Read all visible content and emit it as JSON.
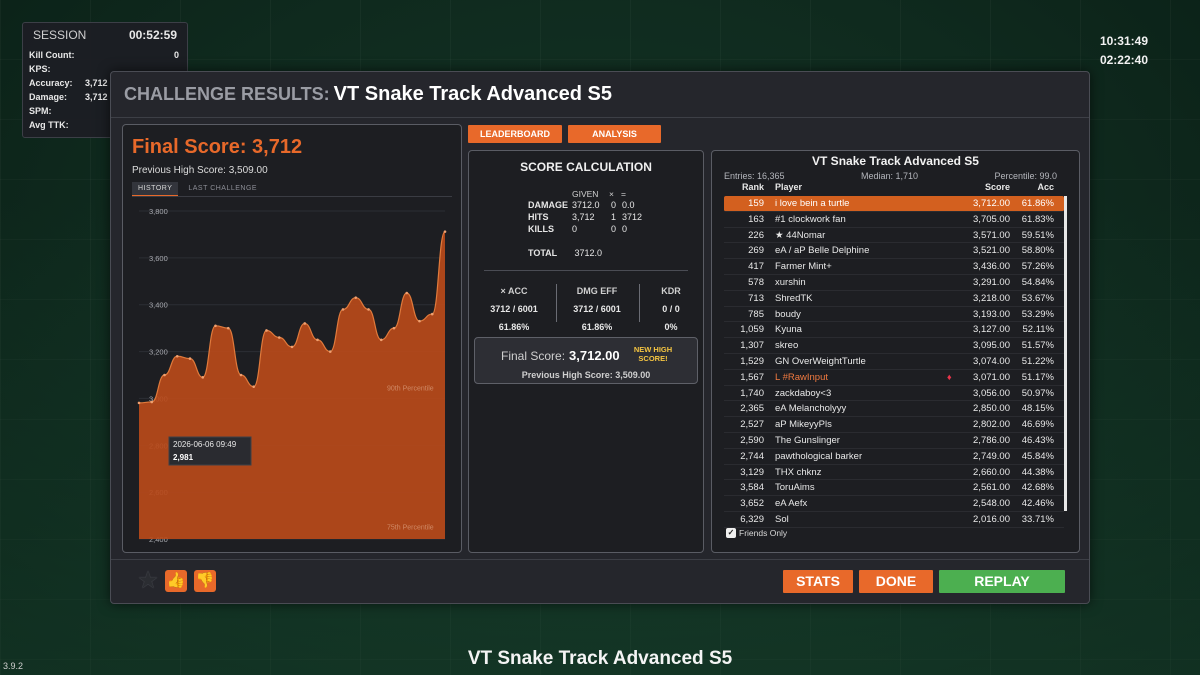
{
  "session": {
    "label": "SESSION",
    "time": "00:52:59",
    "rows": [
      {
        "key": "Kill Count:",
        "value": "0",
        "right": true
      },
      {
        "key": "KPS:",
        "value": "",
        "right": false
      },
      {
        "key": "Accuracy:",
        "value": "3,712",
        "right": false
      },
      {
        "key": "Damage:",
        "value": "3,712",
        "right": false
      },
      {
        "key": "SPM:",
        "value": "",
        "right": false
      },
      {
        "key": "Avg TTK:",
        "value": "",
        "right": false
      }
    ]
  },
  "clock": {
    "time": "10:31:49",
    "elapsed": "02:22:40"
  },
  "version": "3.9.2",
  "bottom_title": "VT Snake Track Advanced S5",
  "panel": {
    "prefix": "CHALLENGE RESULTS:",
    "name": "VT Snake Track Advanced S5"
  },
  "history": {
    "final_label": "Final Score: 3,712",
    "prev_high": "Previous High Score: 3,509.00",
    "tabs": [
      "HISTORY",
      "LAST CHALLENGE"
    ],
    "tooltip_date": "2026-06-06 09:49",
    "tooltip_value": "2,981",
    "ref_90": "90th Percentile",
    "ref_75": "75th Percentile"
  },
  "tabs": {
    "leaderboard": "LEADERBOARD",
    "analysis": "ANALYSIS"
  },
  "calc": {
    "title": "SCORE CALCULATION",
    "head_given": "GIVEN",
    "head_x": "×",
    "head_eq": "=",
    "rows": [
      {
        "k": "DAMAGE",
        "a": "3712.0",
        "b": "0",
        "c": "0.0"
      },
      {
        "k": "HITS",
        "a": "3,712",
        "b": "1",
        "c": "3712"
      },
      {
        "k": "KILLS",
        "a": "0",
        "b": "0",
        "c": "0"
      }
    ],
    "total_k": "TOTAL",
    "total_v": "3712.0",
    "acc_h": "× ACC",
    "acc_1": "3712 / 6001",
    "acc_2": "61.86%",
    "dmg_h": "DMG EFF",
    "dmg_1": "3712 / 6001",
    "dmg_2": "61.86%",
    "kdr_h": "KDR",
    "kdr_1": "0 / 0",
    "kdr_2": "0%",
    "final_label": "Final Score:",
    "final_value": "3,712.00",
    "new_high": "NEW HIGH SCORE!",
    "prev_high": "Previous High Score: 3,509.00"
  },
  "leaderboard": {
    "title": "VT Snake Track Advanced S5",
    "entries": "Entries: 16,365",
    "median": "Median: 1,710",
    "percentile": "Percentile: 99.0",
    "head": {
      "rank": "Rank",
      "player": "Player",
      "score": "Score",
      "acc": "Acc"
    },
    "rows": [
      {
        "rank": "159",
        "player": "i love bein a turtle",
        "score": "3,712.00",
        "acc": "61.86%"
      },
      {
        "rank": "163",
        "player": "#1 clockwork fan",
        "score": "3,705.00",
        "acc": "61.83%"
      },
      {
        "rank": "226",
        "player": "★ 44Nomar",
        "score": "3,571.00",
        "acc": "59.51%"
      },
      {
        "rank": "269",
        "player": "eA / aP Belle Delphine",
        "score": "3,521.00",
        "acc": "58.80%"
      },
      {
        "rank": "417",
        "player": "Farmer Mint+",
        "score": "3,436.00",
        "acc": "57.26%"
      },
      {
        "rank": "578",
        "player": "xurshin",
        "score": "3,291.00",
        "acc": "54.84%"
      },
      {
        "rank": "713",
        "player": "ShredTK",
        "score": "3,218.00",
        "acc": "53.67%"
      },
      {
        "rank": "785",
        "player": "boudy",
        "score": "3,193.00",
        "acc": "53.29%"
      },
      {
        "rank": "1,059",
        "player": "Kyuna",
        "score": "3,127.00",
        "acc": "52.11%"
      },
      {
        "rank": "1,307",
        "player": "skreo",
        "score": "3,095.00",
        "acc": "51.57%"
      },
      {
        "rank": "1,529",
        "player": "GN OverWeightTurtle",
        "score": "3,074.00",
        "acc": "51.22%"
      },
      {
        "rank": "1,567",
        "player": "L #RawInput",
        "score": "3,071.00",
        "acc": "51.17%"
      },
      {
        "rank": "1,740",
        "player": "zackdaboy<3",
        "score": "3,056.00",
        "acc": "50.97%"
      },
      {
        "rank": "2,365",
        "player": "eA Melancholyyy",
        "score": "2,850.00",
        "acc": "48.15%"
      },
      {
        "rank": "2,527",
        "player": "aP MikeyyPls",
        "score": "2,802.00",
        "acc": "46.69%"
      },
      {
        "rank": "2,590",
        "player": "The Gunslinger",
        "score": "2,786.00",
        "acc": "46.43%"
      },
      {
        "rank": "2,744",
        "player": "pawthological barker",
        "score": "2,749.00",
        "acc": "45.84%"
      },
      {
        "rank": "3,129",
        "player": "THX chknz",
        "score": "2,660.00",
        "acc": "44.38%"
      },
      {
        "rank": "3,584",
        "player": "ToruAims",
        "score": "2,561.00",
        "acc": "42.68%"
      },
      {
        "rank": "3,652",
        "player": "eA Aefx",
        "score": "2,548.00",
        "acc": "42.46%"
      },
      {
        "rank": "6,329",
        "player": "Sol",
        "score": "2,016.00",
        "acc": "33.71%"
      }
    ],
    "friends_only": "Friends Only"
  },
  "footer": {
    "stats": "STATS",
    "done": "DONE",
    "replay": "REPLAY"
  },
  "colors": {
    "accent": "#e8692a",
    "replay": "#4caf50",
    "area": "#b84a1a"
  },
  "chart_data": {
    "type": "area",
    "title": "",
    "ylim": [
      2400,
      3800
    ],
    "yticks": [
      "3,800",
      "3,600",
      "3,400",
      "3,200",
      "3,000",
      "2,800",
      "2,600",
      "2,400"
    ],
    "values": [
      2981,
      2985,
      3100,
      3180,
      3170,
      3090,
      3310,
      3300,
      3100,
      3050,
      3290,
      3260,
      3220,
      3320,
      3250,
      3200,
      3380,
      3430,
      3380,
      3250,
      3300,
      3450,
      3330,
      3360,
      3712
    ],
    "ref_lines": [
      {
        "label": "90th Percentile",
        "value": 3000
      },
      {
        "label": "75th Percentile",
        "value": 2440
      }
    ]
  }
}
